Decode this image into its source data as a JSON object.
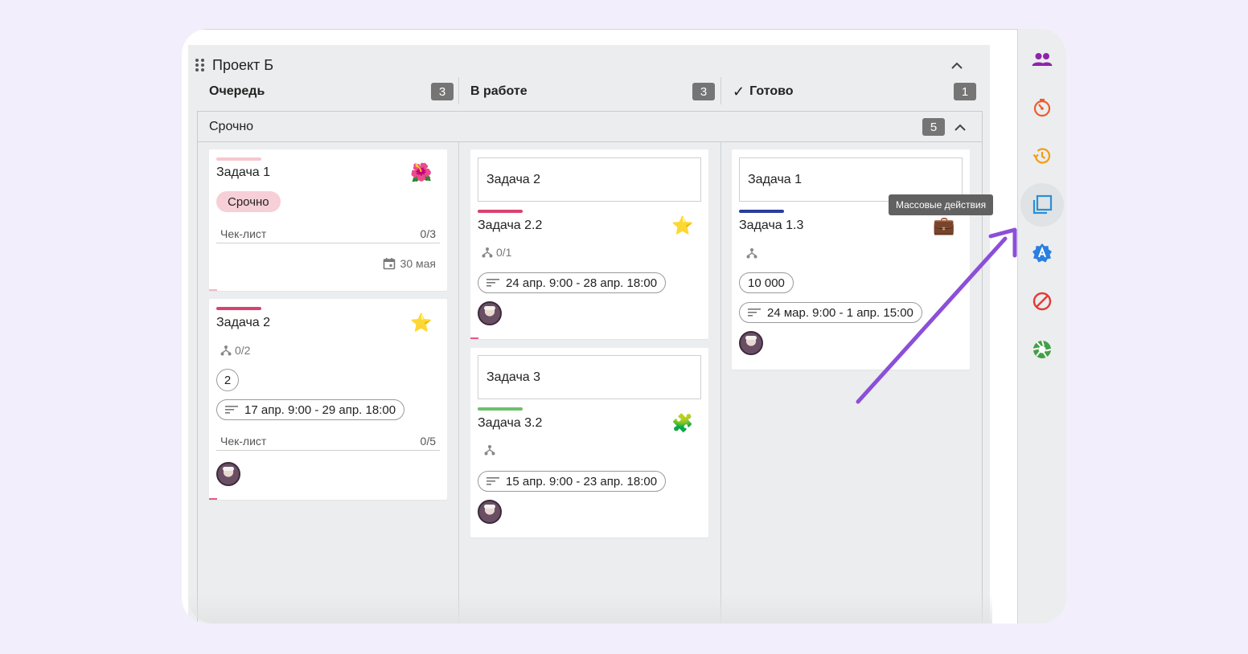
{
  "project": {
    "title": "Проект Б"
  },
  "columns": [
    {
      "label": "Очередь",
      "count": "3"
    },
    {
      "label": "В работе",
      "count": "3"
    },
    {
      "label": "Готово",
      "count": "1",
      "check": "✓"
    }
  ],
  "swimlane": {
    "label": "Срочно",
    "count": "5"
  },
  "cards": {
    "c1": {
      "title": "Задача 1",
      "emoji": "🌺",
      "bar_color": "#f7c6cf",
      "tag": "Срочно",
      "checklist_label": "Чек-лист",
      "checklist_count": "0/3",
      "due": "30 мая"
    },
    "c2": {
      "title": "Задача 2",
      "emoji": "⭐",
      "bar_color": "#d9426e",
      "subtasks": "0/2",
      "estimate": "2",
      "dates": "17 апр. 9:00 - 29 апр. 18:00",
      "checklist_label": "Чек-лист",
      "checklist_count": "0/5"
    },
    "c3": {
      "parent": "Задача 2",
      "title": "Задача 2.2",
      "emoji": "⭐",
      "bar_color": "#d9426e",
      "subtasks": "0/1",
      "dates": "24 апр. 9:00 - 28 апр. 18:00"
    },
    "c4": {
      "parent": "Задача 3",
      "title": "Задача 3.2",
      "emoji": "🧩",
      "bar_color": "#6fbf6a",
      "dates": "15 апр. 9:00 - 23 апр. 18:00"
    },
    "c5": {
      "parent": "Задача 1",
      "title": "Задача 1.3",
      "emoji": "💼",
      "bar_color": "#283e9c",
      "estimate": "10 000",
      "dates": "24 мар. 9:00 - 1 апр. 15:00"
    }
  },
  "sidebar": {
    "items": [
      {
        "icon": "people-icon",
        "color": "#8e24aa"
      },
      {
        "icon": "timer-icon",
        "color": "#ef5a2b"
      },
      {
        "icon": "history-icon",
        "color": "#f39c12"
      },
      {
        "icon": "bulk-actions-icon",
        "color": "#2a8fd4"
      },
      {
        "icon": "auto-badge-icon",
        "color": "#2a7fe0"
      },
      {
        "icon": "block-icon",
        "color": "#e53935"
      },
      {
        "icon": "aperture-icon",
        "color": "#43a047"
      }
    ],
    "tooltip": "Массовые действия"
  },
  "colors": {
    "accent_arrow": "#8b4fd8",
    "badge": "#757575",
    "board_bg": "#ebedee"
  }
}
